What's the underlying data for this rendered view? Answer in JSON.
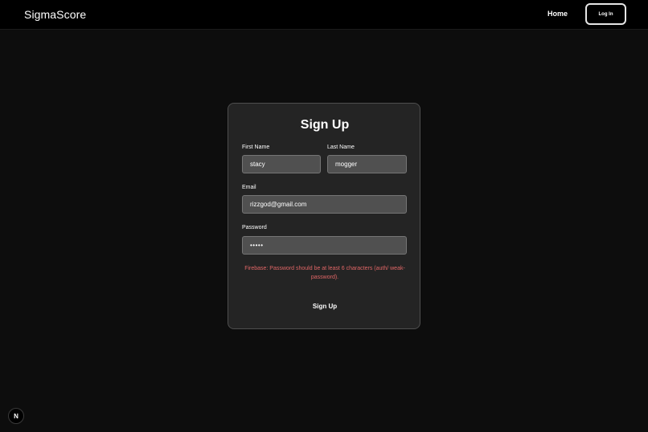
{
  "header": {
    "brand": "SigmaScore",
    "nav_home": "Home",
    "login_label": "Log In"
  },
  "signup_card": {
    "title": "Sign Up",
    "first_name": {
      "label": "First Name",
      "value": "stacy"
    },
    "last_name": {
      "label": "Last Name",
      "value": "mogger"
    },
    "email": {
      "label": "Email",
      "value": "rizzgod@gmail.com"
    },
    "password": {
      "label": "Password",
      "masked_value": "•••••"
    },
    "error_message": "Firebase: Password should be at least 6 characters (auth/ weak-password).",
    "submit_label": "Sign Up"
  },
  "dev_badge": {
    "label": "N",
    "icon": "nextjs-icon"
  },
  "colors": {
    "background": "#0d0d0d",
    "header_background": "#000000",
    "card_background": "#242424",
    "input_background": "#505050",
    "error_text": "#e06666"
  }
}
